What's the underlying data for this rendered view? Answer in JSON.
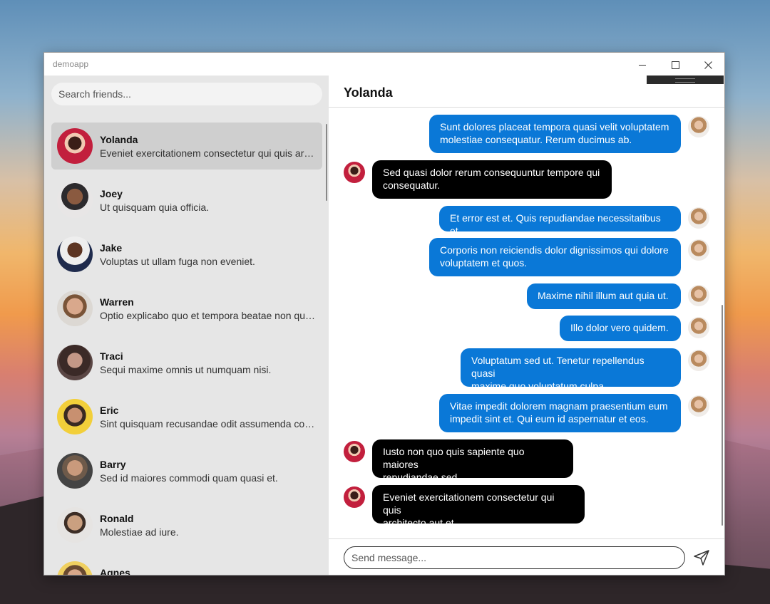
{
  "window": {
    "title": "demoapp"
  },
  "sidebar": {
    "search_placeholder": "Search friends...",
    "friends": [
      {
        "name": "Yolanda",
        "preview": "Eveniet exercitationem consectetur qui quis architecto aut et.",
        "selected": true
      },
      {
        "name": "Joey",
        "preview": "Ut quisquam quia officia."
      },
      {
        "name": "Jake",
        "preview": "Voluptas ut ullam fuga non eveniet."
      },
      {
        "name": "Warren",
        "preview": "Optio explicabo quo et tempora beatae non quam."
      },
      {
        "name": "Traci",
        "preview": "Sequi maxime omnis ut numquam nisi."
      },
      {
        "name": "Eric",
        "preview": "Sint quisquam recusandae odit assumenda consequatur."
      },
      {
        "name": "Barry",
        "preview": "Sed id maiores commodi quam quasi et."
      },
      {
        "name": "Ronald",
        "preview": "Molestiae ad iure."
      },
      {
        "name": "Agnes",
        "preview": ""
      }
    ]
  },
  "chat": {
    "title": "Yolanda",
    "messages": [
      {
        "direction": "out",
        "line1": "Sunt dolores placeat tempora quasi velit voluptatem",
        "line2": "molestiae consequatur. Rerum ducimus ab."
      },
      {
        "direction": "in",
        "line1": "Sed quasi dolor rerum consequuntur tempore qui",
        "line2": "consequatur."
      },
      {
        "direction": "out",
        "line1": "Et error est et. Quis repudiandae necessitatibus et.",
        "line2": ""
      },
      {
        "direction": "out",
        "line1": "Corporis non reiciendis dolor dignissimos qui dolore",
        "line2": "voluptatem et quos."
      },
      {
        "direction": "out",
        "line1": "Maxime nihil illum aut quia ut.",
        "line2": ""
      },
      {
        "direction": "out",
        "line1": "Illo dolor vero quidem.",
        "line2": ""
      },
      {
        "direction": "out",
        "line1": "Voluptatum sed ut. Tenetur repellendus quasi",
        "line2": "maxime quo voluptatum culpa."
      },
      {
        "direction": "out",
        "line1": "Vitae impedit dolorem magnam praesentium eum",
        "line2": "impedit sint et. Qui eum id aspernatur et eos."
      },
      {
        "direction": "in",
        "line1": "Iusto non quo quis sapiente quo maiores",
        "line2": "repudiandae sed."
      },
      {
        "direction": "in",
        "line1": "Eveniet exercitationem consectetur qui quis",
        "line2": "architecto aut et."
      }
    ]
  },
  "composer": {
    "placeholder": "Send message..."
  },
  "icons": {
    "send": "send-icon",
    "minimize": "minimize-icon",
    "maximize": "maximize-icon",
    "close": "close-icon"
  },
  "colors": {
    "outgoing_bubble": "#0a78d7",
    "incoming_bubble": "#000000",
    "selected_item": "#cfcfcf",
    "sidebar_bg": "#e6e6e6"
  }
}
